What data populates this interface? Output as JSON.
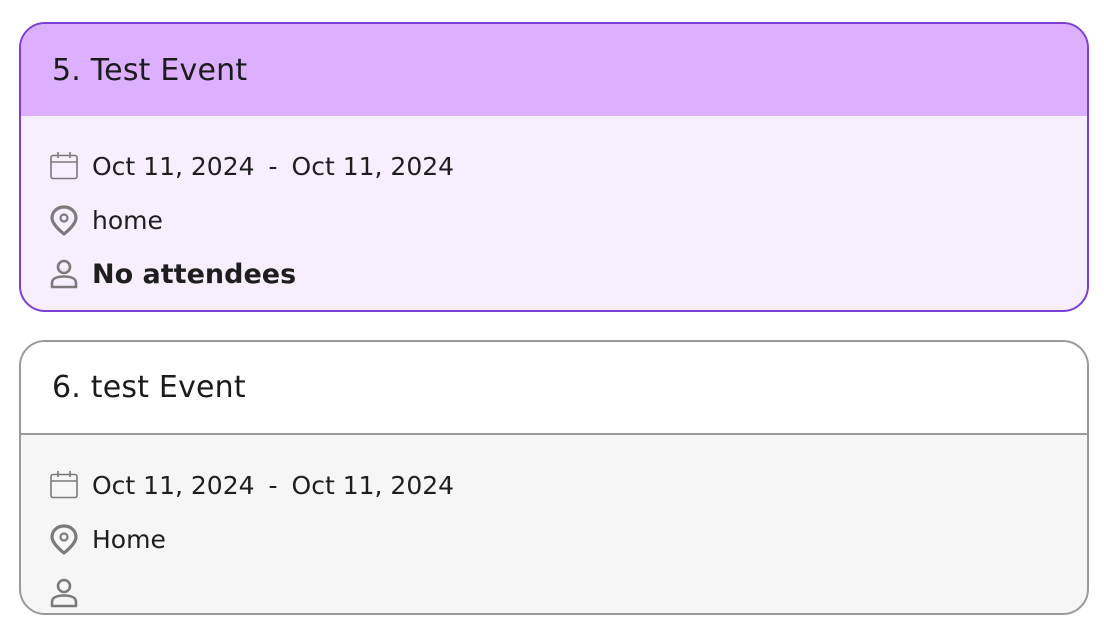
{
  "events": [
    {
      "title": "5. Test Event",
      "start_date": "Oct 11, 2024",
      "separator": "-",
      "end_date": "Oct 11, 2024",
      "location": "home",
      "attendees": "No attendees"
    },
    {
      "title": "6. test Event",
      "start_date": "Oct 11, 2024",
      "separator": "-",
      "end_date": "Oct 11, 2024",
      "location": "Home",
      "attendees": ""
    }
  ],
  "colors": {
    "selected_border": "#7b3fd6",
    "selected_header": "#dcb0ff",
    "selected_body": "#f7eefe",
    "default_border": "#9a9a9a",
    "default_body": "#f6f6f6"
  },
  "icons": [
    "calendar-icon",
    "location-pin-icon",
    "person-icon"
  ]
}
